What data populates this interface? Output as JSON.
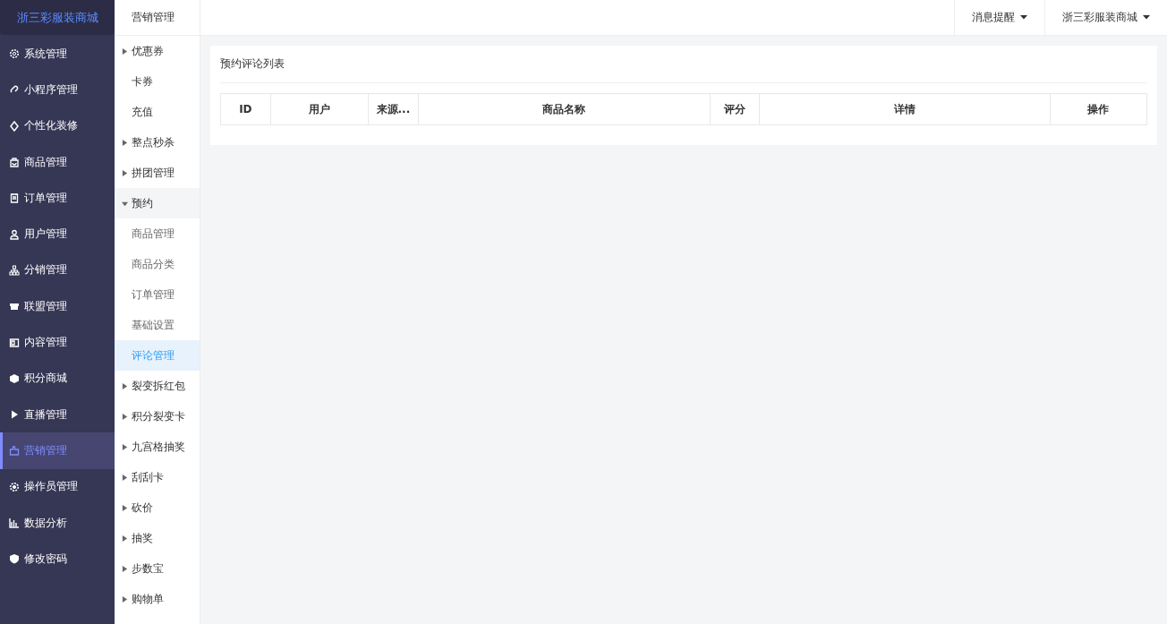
{
  "brand": "浙三彩服装商城",
  "sidebar": {
    "items": [
      {
        "label": "系统管理",
        "selected": false
      },
      {
        "label": "小程序管理",
        "selected": false
      },
      {
        "label": "个性化装修",
        "selected": false
      },
      {
        "label": "商品管理",
        "selected": false
      },
      {
        "label": "订单管理",
        "selected": false
      },
      {
        "label": "用户管理",
        "selected": false
      },
      {
        "label": "分销管理",
        "selected": false
      },
      {
        "label": "联盟管理",
        "selected": false
      },
      {
        "label": "内容管理",
        "selected": false
      },
      {
        "label": "积分商城",
        "selected": false
      },
      {
        "label": "直播管理",
        "selected": false
      },
      {
        "label": "营销管理",
        "selected": true
      },
      {
        "label": "操作员管理",
        "selected": false
      },
      {
        "label": "数据分析",
        "selected": false
      },
      {
        "label": "修改密码",
        "selected": false
      }
    ]
  },
  "submenu": {
    "title": "营销管理",
    "items": [
      {
        "label": "优惠券",
        "kind": "group",
        "expanded": false,
        "selected": false
      },
      {
        "label": "卡券",
        "kind": "link",
        "selected": false
      },
      {
        "label": "充值",
        "kind": "link",
        "selected": false
      },
      {
        "label": "整点秒杀",
        "kind": "group",
        "expanded": false,
        "selected": false
      },
      {
        "label": "拼团管理",
        "kind": "group",
        "expanded": false,
        "selected": false
      },
      {
        "label": "预约",
        "kind": "group",
        "expanded": true,
        "selected": false,
        "children": [
          {
            "label": "商品管理",
            "selected": false
          },
          {
            "label": "商品分类",
            "selected": false
          },
          {
            "label": "订单管理",
            "selected": false
          },
          {
            "label": "基础设置",
            "selected": false
          },
          {
            "label": "评论管理",
            "selected": true
          }
        ]
      },
      {
        "label": "裂变拆红包",
        "kind": "group",
        "expanded": false,
        "selected": false
      },
      {
        "label": "积分裂变卡",
        "kind": "group",
        "expanded": false,
        "selected": false
      },
      {
        "label": "九宫格抽奖",
        "kind": "group",
        "expanded": false,
        "selected": false
      },
      {
        "label": "刮刮卡",
        "kind": "group",
        "expanded": false,
        "selected": false
      },
      {
        "label": "砍价",
        "kind": "group",
        "expanded": false,
        "selected": false
      },
      {
        "label": "抽奖",
        "kind": "group",
        "expanded": false,
        "selected": false
      },
      {
        "label": "步数宝",
        "kind": "group",
        "expanded": false,
        "selected": false
      },
      {
        "label": "购物单",
        "kind": "group",
        "expanded": false,
        "selected": false
      }
    ]
  },
  "topbar": {
    "menus": [
      "消息提醒",
      "浙三彩服装商城"
    ]
  },
  "panel": {
    "title": "预约评论列表",
    "table": {
      "columns": [
        "ID",
        "用户",
        "来源...",
        "商品名称",
        "评分",
        "详情",
        "操作"
      ]
    }
  }
}
